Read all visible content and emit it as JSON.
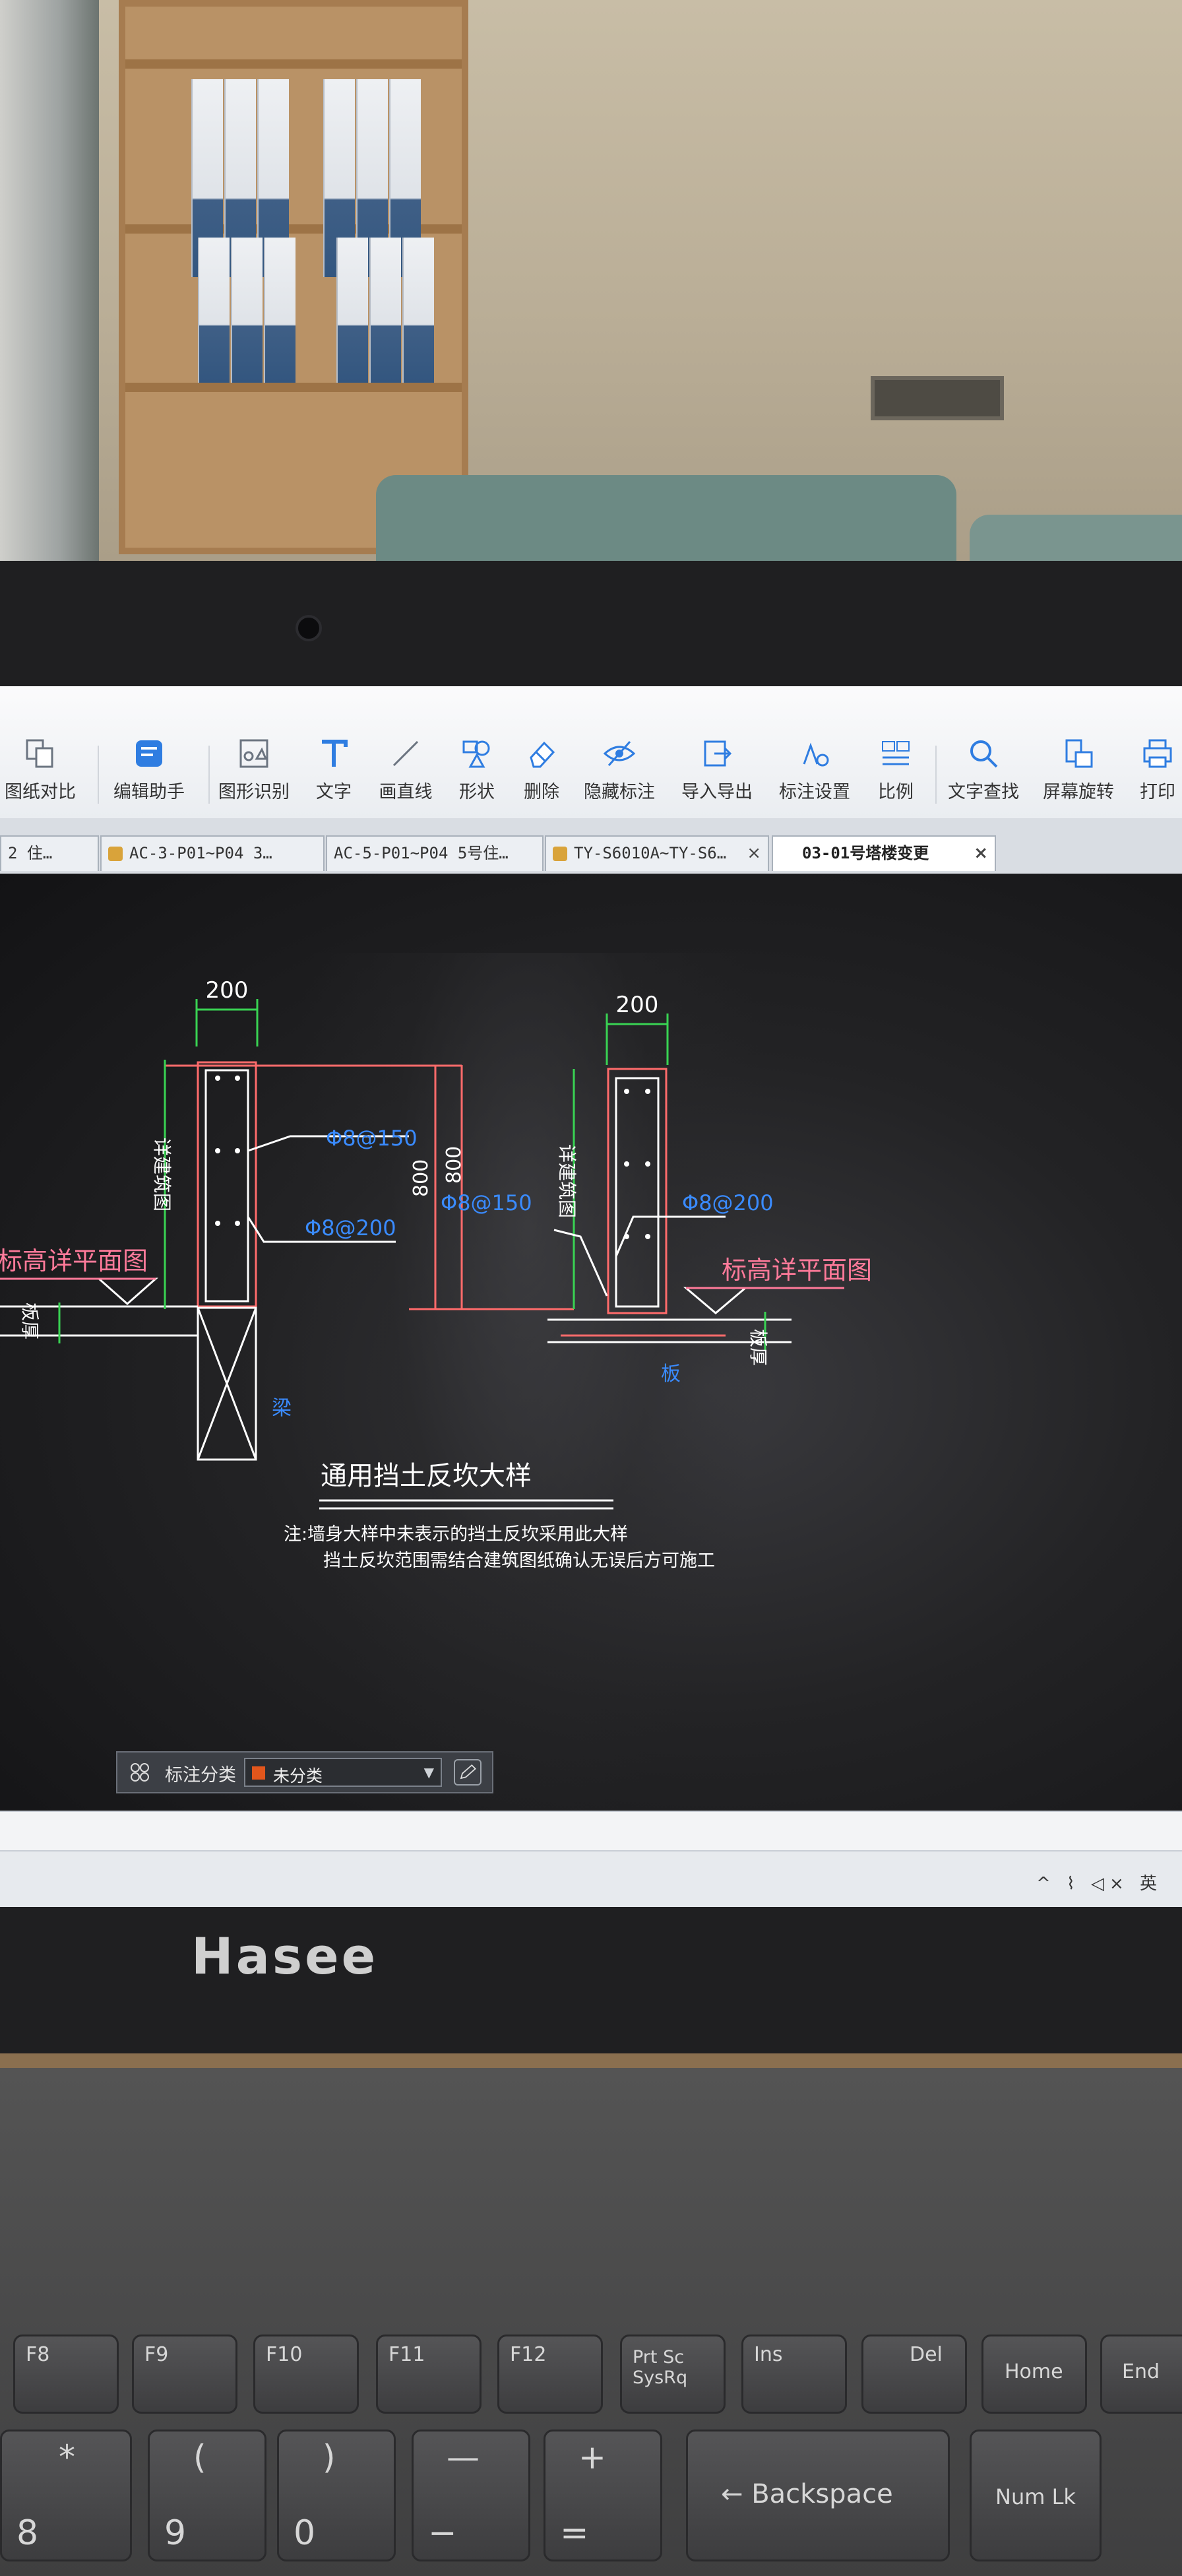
{
  "toolbar": {
    "items": [
      {
        "label": "图纸对比",
        "icon": "compare-icon"
      },
      {
        "label": "编辑助手",
        "icon": "edit-assistant-icon"
      },
      {
        "label": "图形识别",
        "icon": "shape-recognition-icon"
      },
      {
        "label": "文字",
        "icon": "text-icon"
      },
      {
        "label": "画直线",
        "icon": "line-icon"
      },
      {
        "label": "形状",
        "icon": "shape-icon"
      },
      {
        "label": "删除",
        "icon": "eraser-icon"
      },
      {
        "label": "隐藏标注",
        "icon": "eye-hidden-icon"
      },
      {
        "label": "导入导出",
        "icon": "import-export-icon"
      },
      {
        "label": "标注设置",
        "icon": "annotation-settings-icon"
      },
      {
        "label": "比例",
        "icon": "scale-icon"
      },
      {
        "label": "文字查找",
        "icon": "text-search-icon"
      },
      {
        "label": "屏幕旋转",
        "icon": "rotate-screen-icon"
      },
      {
        "label": "打印",
        "icon": "printer-icon"
      }
    ]
  },
  "tabs": [
    {
      "label": "2  住…",
      "locked": false
    },
    {
      "label": "AC-3-P01~P04 3…",
      "locked": true
    },
    {
      "label": "AC-5-P01~P04 5号住…",
      "locked": false
    },
    {
      "label": "TY-S6010A~TY-S6…",
      "locked": true
    },
    {
      "label": "03-01号塔楼变更",
      "locked": false,
      "active": true
    }
  ],
  "tab_close": "×",
  "drawing": {
    "dim_200_left": "200",
    "dim_200_right": "200",
    "dim_800_left": "800",
    "dim_800_right": "800",
    "rebar_150_left": "Φ8@150",
    "rebar_200_left": "Φ8@200",
    "rebar_150_right": "Φ8@150",
    "rebar_200_right": "Φ8@200",
    "arch_ref_left": "详建筑图",
    "arch_ref_right": "详建筑图",
    "elev_left": "标高详平面图",
    "elev_right": "标高详平面图",
    "slab_thk_left": "板厚",
    "slab_thk_right": "板厚",
    "beam": "梁",
    "slab": "板",
    "title": "通用挡土反坎大样",
    "note_1": "注:墙身大样中未表示的挡土反坎采用此大样",
    "note_2": "挡土反坎范围需结合建筑图纸确认无误后方可施工"
  },
  "annotation_panel": {
    "label": "标注分类",
    "value": "未分类",
    "swatch_color": "#e2561c"
  },
  "tray": {
    "text": "^ ⌇ ◁× 英"
  },
  "brand": "Hasee",
  "keyboard": {
    "row1": [
      "F8",
      "F9",
      "F10",
      "F11",
      "F12",
      "Prt Sc\nSysRq",
      "Ins",
      "Del",
      "Home",
      "End"
    ],
    "row2": [
      {
        "top": "*",
        "bot": "8"
      },
      {
        "top": "(",
        "bot": "9"
      },
      {
        "top": ")",
        "bot": "0"
      },
      {
        "top": "—",
        "bot": "−"
      },
      {
        "top": "+",
        "bot": "="
      }
    ],
    "backspace": "← Backspace",
    "numlk": "Num Lk"
  }
}
